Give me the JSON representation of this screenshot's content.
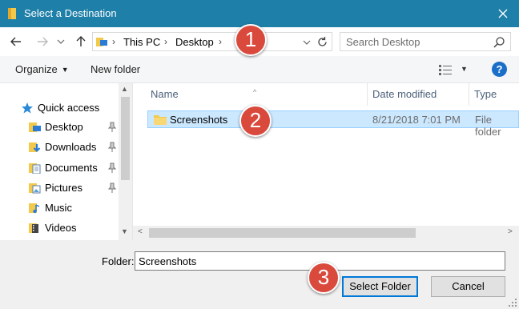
{
  "window": {
    "title": "Select a Destination",
    "close_icon": "close-icon",
    "title_bar_color": "#1e7fa8"
  },
  "nav": {
    "back_icon": "arrow-left-icon",
    "forward_icon": "arrow-right-icon",
    "recent_icon": "chevron-down-icon",
    "up_icon": "arrow-up-icon",
    "breadcrumbs": [
      "This PC",
      "Desktop"
    ],
    "search_placeholder": "Search Desktop"
  },
  "toolbar": {
    "organize_label": "Organize",
    "new_folder_label": "New folder",
    "help_label": "?"
  },
  "sidebar": {
    "quick_access": "Quick access",
    "items": [
      {
        "label": "Desktop",
        "icon": "desktop-folder-icon",
        "pinned": true
      },
      {
        "label": "Downloads",
        "icon": "downloads-folder-icon",
        "pinned": true
      },
      {
        "label": "Documents",
        "icon": "documents-folder-icon",
        "pinned": true
      },
      {
        "label": "Pictures",
        "icon": "pictures-folder-icon",
        "pinned": true
      },
      {
        "label": "Music",
        "icon": "music-folder-icon",
        "pinned": false
      },
      {
        "label": "Videos",
        "icon": "videos-folder-icon",
        "pinned": false
      }
    ]
  },
  "files": {
    "columns": [
      "Name",
      "Date modified",
      "Type"
    ],
    "rows": [
      {
        "name": "Screenshots",
        "date": "8/21/2018 7:01 PM",
        "type": "File folder",
        "selected": true
      }
    ]
  },
  "footer": {
    "folder_label": "Folder:",
    "folder_value": "Screenshots",
    "select_button": "Select Folder",
    "cancel_button": "Cancel"
  },
  "annotations": {
    "badges": [
      "1",
      "2",
      "3"
    ],
    "badge_color": "#d94a3d"
  },
  "colors": {
    "selection": "#cce8ff",
    "accent": "#0078d7"
  }
}
